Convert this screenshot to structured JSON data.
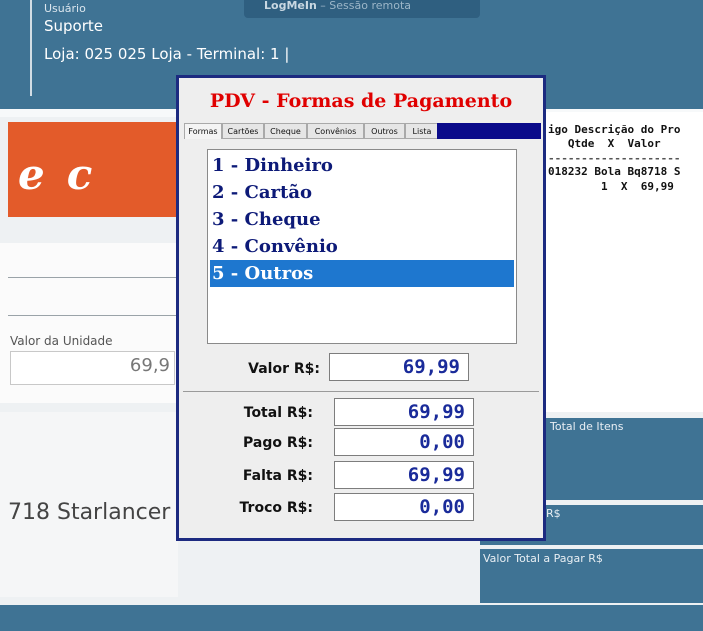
{
  "session": {
    "app": "LogMeIn",
    "label": "Sessão remota"
  },
  "header": {
    "user_label": "Usuário",
    "user_name": "Suporte",
    "store_line": "Loja: 025 025 Loja - Terminal: 1 |"
  },
  "left": {
    "unit_value_label": "Valor da Unidade",
    "unit_value": "69,9",
    "product_name": "718 Starlancer"
  },
  "receipt": {
    "header1": "igo Descrição do Pro",
    "header2": "   Qtde  X  Valor",
    "separator": "--------------------",
    "line1": "018232 Bola Bq8718 S",
    "line2": "        1  X  69,99"
  },
  "right_panels": {
    "total_items_label": "Total de Itens",
    "rs_label": "R$",
    "total_pay_label": "Valor Total a Pagar R$"
  },
  "dialog": {
    "title": "PDV - Formas de Pagamento",
    "tabs": [
      "Formas",
      "Cartões",
      "Cheque",
      "Convênios",
      "Outros",
      "Lista"
    ],
    "options": [
      "1 - Dinheiro",
      "2 - Cartão",
      "3 - Cheque",
      "4 - Convênio",
      "5 - Outros"
    ],
    "selected_option": "5 - Outros",
    "valor_label": "Valor R$:",
    "valor": "69,99",
    "total_label": "Total R$:",
    "total": "69,99",
    "pago_label": "Pago R$:",
    "pago": "0,00",
    "falta_label": "Falta R$:",
    "falta": "69,99",
    "troco_label": "Troco R$:",
    "troco": "0,00"
  },
  "colors": {
    "header_blue": "#3f7394",
    "dialog_border": "#1c2a80",
    "title_red": "#e00000",
    "selection_blue": "#1e77cf",
    "brand_orange": "#e35b2a"
  }
}
